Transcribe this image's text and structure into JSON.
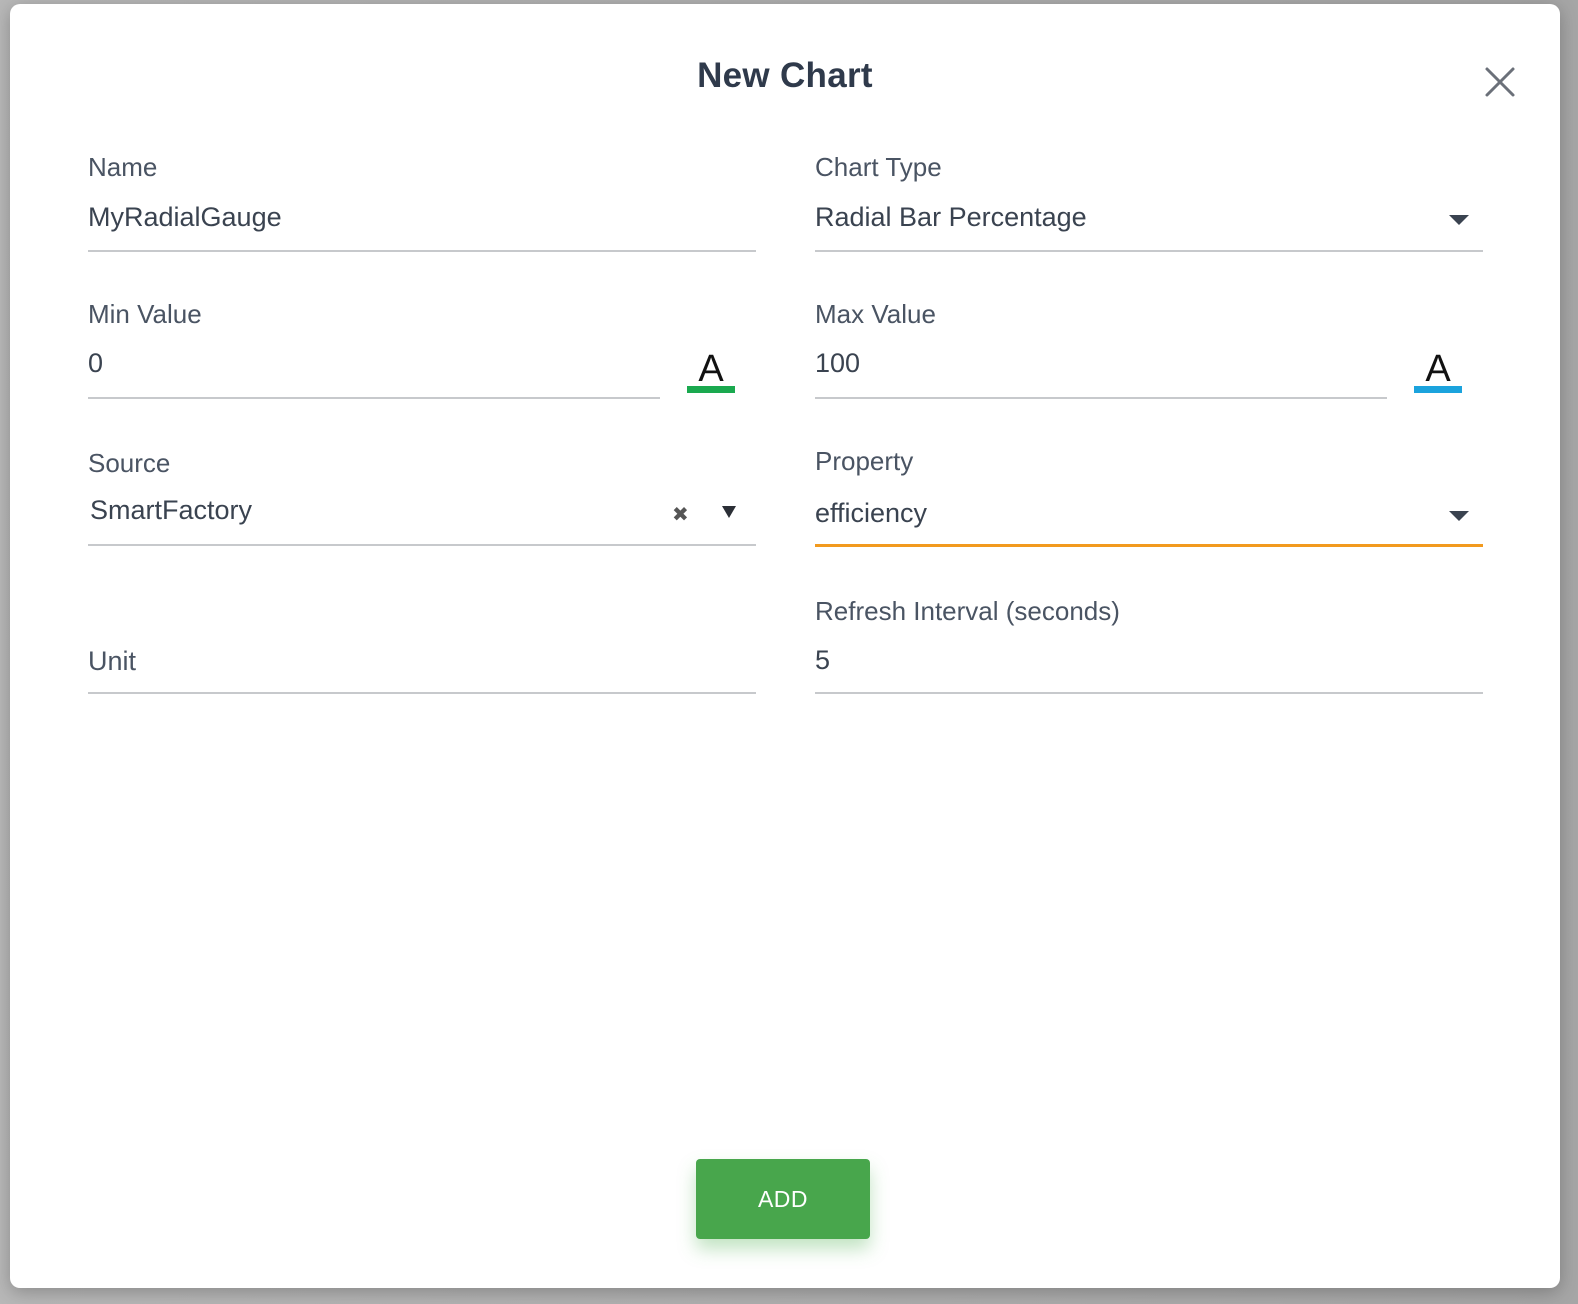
{
  "dialog": {
    "title": "New Chart",
    "close_icon": "close-icon"
  },
  "fields": {
    "name": {
      "label": "Name",
      "value": "MyRadialGauge"
    },
    "chart_type": {
      "label": "Chart Type",
      "value": "Radial Bar Percentage",
      "icon": "chevron-down-icon"
    },
    "min_value": {
      "label": "Min Value",
      "value": "0",
      "color_letter": "A",
      "color": "#1aa94f",
      "icon": "text-color-icon"
    },
    "max_value": {
      "label": "Max Value",
      "value": "100",
      "color_letter": "A",
      "color": "#1ba3dd",
      "icon": "text-color-icon"
    },
    "source": {
      "label": "Source",
      "value": "SmartFactory",
      "clear_glyph": "✖",
      "icon": "caret-down-icon"
    },
    "property": {
      "label": "Property",
      "value": "efficiency",
      "icon": "chevron-down-icon",
      "focus_color": "#f29a1e"
    },
    "unit": {
      "label": "Unit",
      "value": ""
    },
    "refresh_interval": {
      "label": "Refresh Interval (seconds)",
      "value": "5"
    }
  },
  "actions": {
    "add_label": "ADD",
    "add_color": "#48a64c"
  }
}
